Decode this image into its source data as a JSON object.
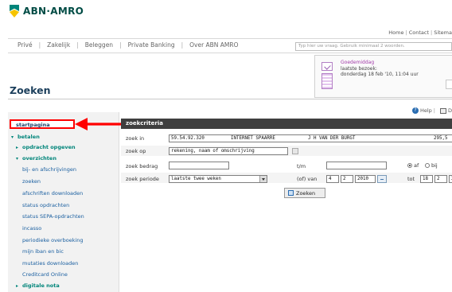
{
  "brand": {
    "logo_text": "ABN·AMRO",
    "color_green": "#00857a",
    "color_yellow": "#f6c400"
  },
  "header": {
    "top_links": [
      "Home",
      "Contact",
      "Sitema"
    ],
    "nav": [
      "Privé",
      "Zakelijk",
      "Beleggen",
      "Private Banking",
      "Over ABN AMRO"
    ],
    "search_placeholder": "Typ hier uw vraag. Gebruik minimaal 2 woorden."
  },
  "welcome": {
    "greeting": "Goedemiddag",
    "last_visit_label": "laatste bezoek:",
    "last_visit_value": "donderdag 18 feb '10, 11:04 uur"
  },
  "page": {
    "title": "Zoeken",
    "help_label": "Help",
    "print_label": "D"
  },
  "sidebar": {
    "highlighted": "startpagina",
    "items": [
      {
        "label": "betalen",
        "level": "group"
      },
      {
        "label": "opdracht opgeven",
        "level": "subgroup"
      },
      {
        "label": "overzichten",
        "level": "subgroup"
      },
      {
        "label": "bij- en afschrijvingen",
        "level": "leaf"
      },
      {
        "label": "zoeken",
        "level": "leaf"
      },
      {
        "label": "afschriften downloaden",
        "level": "leaf"
      },
      {
        "label": "status opdrachten",
        "level": "leaf"
      },
      {
        "label": "status SEPA-opdrachten",
        "level": "leaf"
      },
      {
        "label": "incasso",
        "level": "leaf"
      },
      {
        "label": "periodieke overboeking",
        "level": "leaf"
      },
      {
        "label": "mijn iban en bic",
        "level": "leaf"
      },
      {
        "label": "mutaties downloaden",
        "level": "leaf"
      },
      {
        "label": "Creditcard Online",
        "level": "leaf"
      },
      {
        "label": "digitale nota",
        "level": "subgroup"
      }
    ]
  },
  "form": {
    "section_title": "zoekcriteria",
    "zoek_in_label": "zoek in",
    "account_number": "59.54.92.320",
    "account_type": "INTERNET SPAARRE",
    "account_holder": "J H VAN DER BURGT",
    "account_balance": "295,5",
    "zoek_op_label": "zoek op",
    "zoek_op_value": "rekening, naam of omschrijving",
    "zoek_bedrag_label": "zoek bedrag",
    "tm_label": "t/m",
    "radio_af": "af",
    "radio_bij": "bij",
    "zoek_periode_label": "zoek periode",
    "periode_value": "laatste twee weken",
    "of_van_label": "(of) van",
    "van_day": "4",
    "van_month": "2",
    "van_year": "2010",
    "tot_label": "tot",
    "tot_day": "18",
    "tot_month": "2",
    "tot_year": "2",
    "zoeken_button": "Zoeken"
  },
  "annotation": {
    "arrow_color": "#ff0000"
  }
}
